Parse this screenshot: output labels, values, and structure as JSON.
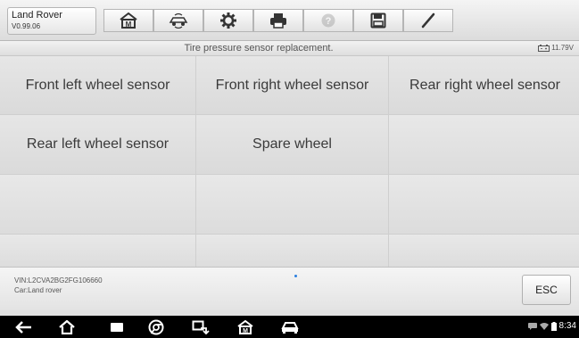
{
  "vehicle": {
    "name": "Land Rover",
    "version": "V0.99.06"
  },
  "toolbar": {
    "buttons": [
      {
        "icon": "home-icon"
      },
      {
        "icon": "vehicle-swap-icon"
      },
      {
        "icon": "gear-icon"
      },
      {
        "icon": "print-icon"
      },
      {
        "icon": "help-icon",
        "disabled": true
      },
      {
        "icon": "save-icon"
      },
      {
        "icon": "pen-icon"
      }
    ]
  },
  "subheader": {
    "title": "Tire pressure sensor replacement.",
    "battery": "11.79V"
  },
  "grid": {
    "cells": [
      "Front left wheel sensor",
      "Front right wheel sensor",
      "Rear right wheel sensor",
      "Rear left wheel sensor",
      "Spare wheel",
      "",
      "",
      "",
      "",
      "",
      "",
      ""
    ]
  },
  "footer": {
    "vin": "VIN:L2CVA2BG2FG106660",
    "car": "Car:Land rover",
    "esc_label": "ESC"
  },
  "navbar": {
    "time": "8:34"
  },
  "colors": {
    "accent": "#2a7fe0",
    "navbar": "#000000"
  }
}
